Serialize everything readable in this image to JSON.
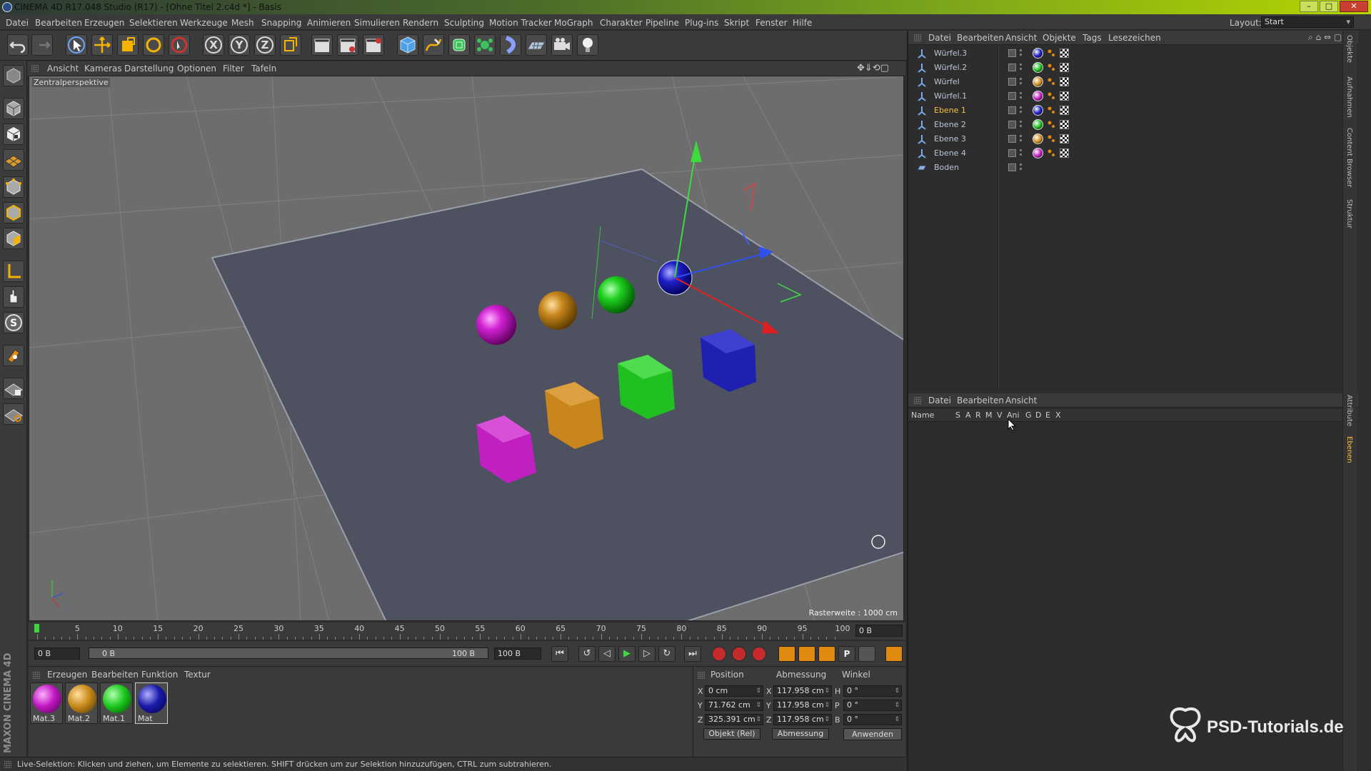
{
  "window": {
    "title": "CINEMA 4D R17.048 Studio (R17) - [Ohne Titel 2.c4d *] - Basis"
  },
  "menubar": {
    "items": [
      "Datei",
      "Bearbeiten",
      "Erzeugen",
      "Selektieren",
      "Werkzeuge",
      "Mesh",
      "Snapping",
      "Animieren",
      "Simulieren",
      "Rendern",
      "Sculpting",
      "Motion Tracker",
      "MoGraph",
      "Charakter",
      "Pipeline",
      "Plug-ins",
      "Skript",
      "Fenster",
      "Hilfe"
    ],
    "layout_label": "Layout:",
    "layout_value": "Start"
  },
  "viewport": {
    "menu": [
      "Ansicht",
      "Kameras",
      "Darstellung",
      "Optionen",
      "Filter",
      "Tafeln"
    ],
    "camera_label": "Zentralperspektive",
    "grid_info": "Rasterweite : 1000 cm"
  },
  "timeline": {
    "ticks": [
      "0",
      "5",
      "10",
      "15",
      "20",
      "25",
      "30",
      "35",
      "40",
      "45",
      "50",
      "55",
      "60",
      "65",
      "70",
      "75",
      "80",
      "85",
      "90",
      "95",
      "100"
    ],
    "current_frame": "0 B",
    "start_field": "0 B",
    "range_start": "0 B",
    "range_end": "100 B",
    "end_field": "100 B"
  },
  "materials": {
    "menu": [
      "Erzeugen",
      "Bearbeiten",
      "Funktion",
      "Textur"
    ],
    "items": [
      {
        "name": "Mat.3",
        "color": "#c218c2"
      },
      {
        "name": "Mat.2",
        "color": "#c98a1a"
      },
      {
        "name": "Mat.1",
        "color": "#1ec81e"
      },
      {
        "name": "Mat",
        "color": "#1a1aa8"
      }
    ]
  },
  "coordinates": {
    "headers": [
      "Position",
      "Abmessung",
      "Winkel"
    ],
    "rows": [
      {
        "axis": "X",
        "pos": "0 cm",
        "size_axis": "X",
        "size": "117.958 cm",
        "rot_axis": "H",
        "rot": "0 °"
      },
      {
        "axis": "Y",
        "pos": "71.762 cm",
        "size_axis": "Y",
        "size": "117.958 cm",
        "rot_axis": "P",
        "rot": "0 °"
      },
      {
        "axis": "Z",
        "pos": "325.391 cm",
        "size_axis": "Z",
        "size": "117.958 cm",
        "rot_axis": "B",
        "rot": "0 °"
      }
    ],
    "mode": "Objekt (Rel)",
    "size_mode": "Abmessung",
    "apply": "Anwenden"
  },
  "status": "Live-Selektion: Klicken und ziehen, um Elemente zu selektieren. SHIFT drücken um zur Selektion hinzuzufügen, CTRL zum subtrahieren.",
  "object_manager": {
    "menu": [
      "Datei",
      "Bearbeiten",
      "Ansicht",
      "Objekte",
      "Tags",
      "Lesezeichen"
    ],
    "objects": [
      {
        "name": "Würfel.3",
        "mat": "#2020c0"
      },
      {
        "name": "Würfel.2",
        "mat": "#20c020"
      },
      {
        "name": "Würfel",
        "mat": "#d09020"
      },
      {
        "name": "Würfel.1",
        "mat": "#c020c0"
      },
      {
        "name": "Ebene 1",
        "mat": "#2020c0",
        "active": true
      },
      {
        "name": "Ebene 2",
        "mat": "#20c020"
      },
      {
        "name": "Ebene 3",
        "mat": "#d09020"
      },
      {
        "name": "Ebene 4",
        "mat": "#c020c0"
      },
      {
        "name": "Boden",
        "mat": ""
      }
    ]
  },
  "layer_manager": {
    "menu": [
      "Datei",
      "Bearbeiten",
      "Ansicht"
    ],
    "columns": [
      "Name",
      "S",
      "A",
      "R",
      "M",
      "V",
      "Ani",
      "G",
      "D",
      "E",
      "X"
    ]
  },
  "side_tabs_top": [
    "Objekte",
    "Aufnahmen",
    "Content Browser",
    "Struktur"
  ],
  "side_tabs_bottom": [
    "Attribute",
    "Ebenen"
  ],
  "side_logo": "MAXON CINEMA 4D",
  "watermark": "PSD-Tutorials.de"
}
